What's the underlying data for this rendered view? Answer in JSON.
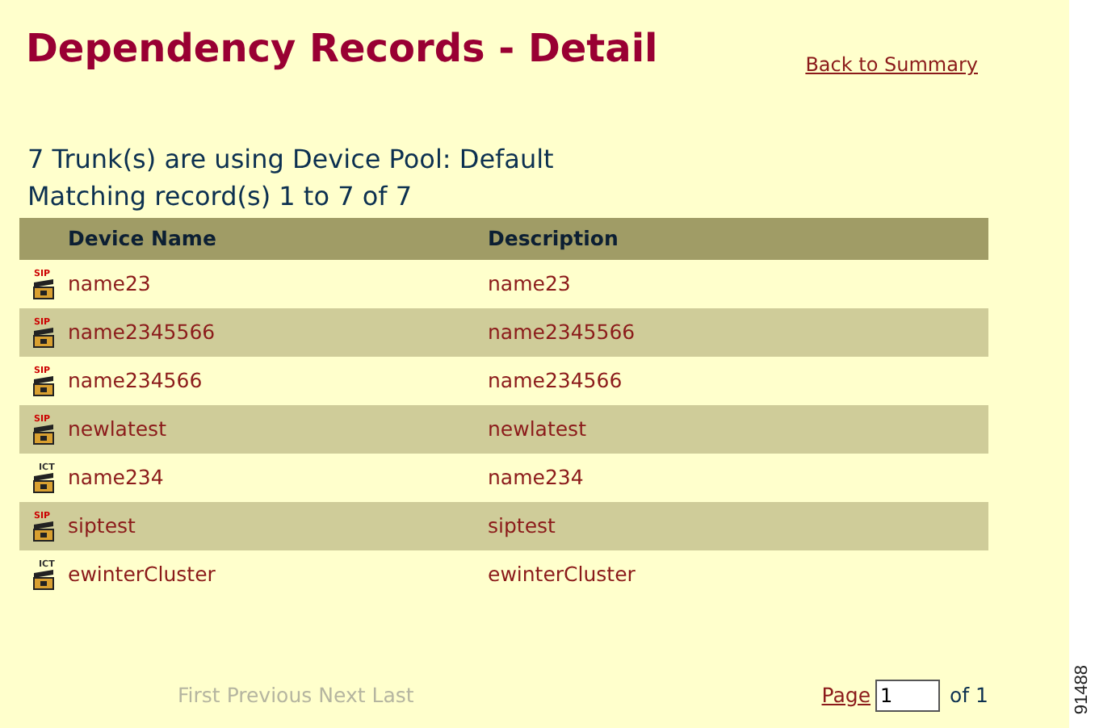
{
  "title": "Dependency Records - Detail",
  "back_link": "Back to Summary",
  "summary": "7 Trunk(s) are using Device Pool: Default",
  "matching": "Matching record(s) 1 to 7 of 7",
  "table": {
    "columns": [
      "Device Name",
      "Description"
    ],
    "rows": [
      {
        "kind": "sip",
        "icon_label": "SIP",
        "device_name": "name23",
        "description": "name23"
      },
      {
        "kind": "sip",
        "icon_label": "SIP",
        "device_name": "name2345566",
        "description": "name2345566"
      },
      {
        "kind": "sip",
        "icon_label": "SIP",
        "device_name": "name234566",
        "description": "name234566"
      },
      {
        "kind": "sip",
        "icon_label": "SIP",
        "device_name": "newlatest",
        "description": "newlatest"
      },
      {
        "kind": "ict",
        "icon_label": "ICT",
        "device_name": "name234",
        "description": "name234"
      },
      {
        "kind": "sip",
        "icon_label": "SIP",
        "device_name": "siptest",
        "description": "siptest"
      },
      {
        "kind": "ict",
        "icon_label": "ICT",
        "device_name": "ewinterCluster",
        "description": "ewinterCluster"
      }
    ]
  },
  "pager": {
    "links": [
      {
        "label": "First",
        "disabled": true
      },
      {
        "label": "Previous",
        "disabled": true
      },
      {
        "label": "Next",
        "disabled": true
      },
      {
        "label": "Last",
        "disabled": true
      }
    ],
    "page_label": "Page",
    "page_value": "1",
    "of_label": "of 1"
  },
  "figure_id": "91488"
}
